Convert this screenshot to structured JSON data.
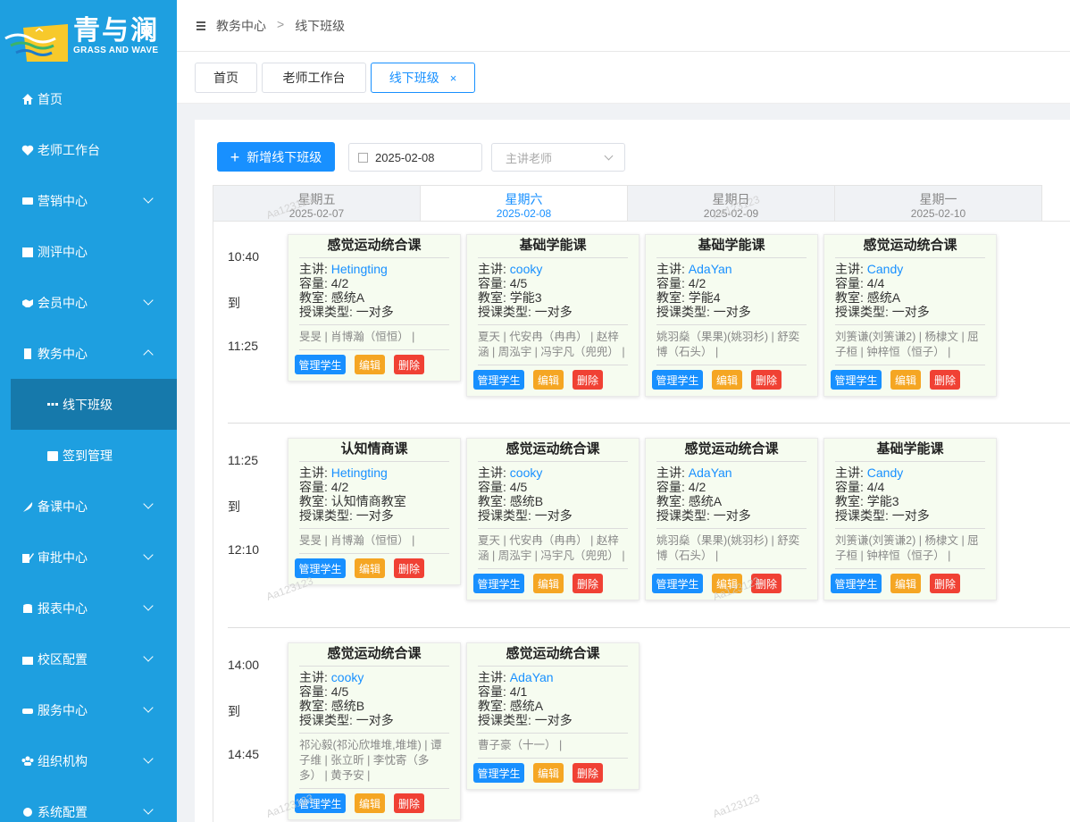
{
  "logo": {
    "cn": "青与澜",
    "en": "GRASS AND WAVE"
  },
  "sidebar": {
    "items": [
      {
        "label": "首页",
        "icon": "home-icon",
        "name": "sidebar-item-home",
        "chevron": false
      },
      {
        "label": "老师工作台",
        "icon": "heart-icon",
        "name": "sidebar-item-teacher-workbench",
        "chevron": false
      },
      {
        "label": "营销中心",
        "icon": "id-card-icon",
        "name": "sidebar-item-marketing",
        "chevron": true
      },
      {
        "label": "测评中心",
        "icon": "calendar-grid-icon",
        "name": "sidebar-item-assessment",
        "chevron": false
      },
      {
        "label": "会员中心",
        "icon": "handshake-icon",
        "name": "sidebar-item-members",
        "chevron": true
      },
      {
        "label": "教务中心",
        "icon": "building-icon",
        "name": "sidebar-item-academic",
        "chevron": true,
        "open": true
      },
      {
        "label": "线下班级",
        "icon": "grid-icon",
        "name": "sidebar-item-offline-class",
        "sub": true,
        "active": true
      },
      {
        "label": "签到管理",
        "icon": "calendar-check-icon",
        "name": "sidebar-item-checkin",
        "sub": true
      },
      {
        "label": "备课中心",
        "icon": "feather-icon",
        "name": "sidebar-item-lesson-prep",
        "chevron": true
      },
      {
        "label": "审批中心",
        "icon": "edit-icon",
        "name": "sidebar-item-approval",
        "chevron": true
      },
      {
        "label": "报表中心",
        "icon": "coins-icon",
        "name": "sidebar-item-reports",
        "chevron": true
      },
      {
        "label": "校区配置",
        "icon": "school-icon",
        "name": "sidebar-item-campus",
        "chevron": true
      },
      {
        "label": "服务中心",
        "icon": "sofa-icon",
        "name": "sidebar-item-service",
        "chevron": true
      },
      {
        "label": "组织机构",
        "icon": "users-icon",
        "name": "sidebar-item-organization",
        "chevron": true
      },
      {
        "label": "系统配置",
        "icon": "gear-icon",
        "name": "sidebar-item-system",
        "chevron": true
      }
    ]
  },
  "breadcrumb": {
    "parent": "教务中心",
    "sep": ">",
    "current": "线下班级"
  },
  "tabs": [
    {
      "label": "首页"
    },
    {
      "label": "老师工作台"
    },
    {
      "label": "线下班级",
      "close": "×"
    }
  ],
  "toolbar": {
    "add_label": "新增线下班级",
    "plus": "+",
    "date_value": "2025-02-08",
    "teacher_placeholder": "主讲老师"
  },
  "days": [
    {
      "weekday": "星期五",
      "date": "2025-02-07"
    },
    {
      "weekday": "星期六",
      "date": "2025-02-08",
      "active": true
    },
    {
      "weekday": "星期日",
      "date": "2025-02-09"
    },
    {
      "weekday": "星期一",
      "date": "2025-02-10"
    }
  ],
  "labels": {
    "teacher": "主讲: ",
    "capacity": "容量: ",
    "room": "教室: ",
    "type": "授课类型: ",
    "manage": "管理学生",
    "edit": "编辑",
    "delete": "删除",
    "to": "到"
  },
  "slots": [
    {
      "start": "10:40",
      "end": "11:25",
      "cards": [
        {
          "title": "感觉运动统合课",
          "teacher": "Hetingting",
          "capacity": "4/2",
          "room": "感统A",
          "type": "一对多",
          "students": "旻旻 | 肖博瀚（恒恒） |"
        },
        {
          "title": "基础学能课",
          "teacher": "cooky",
          "capacity": "4/5",
          "room": "学能3",
          "type": "一对多",
          "students": "夏天 | 代安冉（冉冉） | 赵梓涵 | 周泓宇 | 冯宇凡（兜兜） |"
        },
        {
          "title": "基础学能课",
          "teacher": "AdaYan",
          "capacity": "4/2",
          "room": "学能4",
          "type": "一对多",
          "students": "姚羽燊（果果)(姚羽杉) | 舒奕博（石头） |"
        },
        {
          "title": "感觉运动统合课",
          "teacher": "Candy",
          "capacity": "4/4",
          "room": "感统A",
          "type": "一对多",
          "students": "刘箦谦(刘箦谦2) | 杨棣文 | 屈子桓 | 钟梓恒（恒子） |"
        }
      ]
    },
    {
      "start": "11:25",
      "end": "12:10",
      "cards": [
        {
          "title": "认知情商课",
          "teacher": "Hetingting",
          "capacity": "4/2",
          "room": "认知情商教室",
          "type": "一对多",
          "students": "旻旻 | 肖博瀚（恒恒） |"
        },
        {
          "title": "感觉运动统合课",
          "teacher": "cooky",
          "capacity": "4/5",
          "room": "感统B",
          "type": "一对多",
          "students": "夏天 | 代安冉（冉冉） | 赵梓涵 | 周泓宇 | 冯宇凡（兜兜） |"
        },
        {
          "title": "感觉运动统合课",
          "teacher": "AdaYan",
          "capacity": "4/2",
          "room": "感统A",
          "type": "一对多",
          "students": "姚羽燊（果果)(姚羽杉) | 舒奕博（石头） |"
        },
        {
          "title": "基础学能课",
          "teacher": "Candy",
          "capacity": "4/4",
          "room": "学能3",
          "type": "一对多",
          "students": "刘箦谦(刘箦谦2) | 杨棣文 | 屈子桓 | 钟梓恒（恒子） |"
        }
      ]
    },
    {
      "start": "14:00",
      "end": "14:45",
      "cards": [
        {
          "title": "感觉运动统合课",
          "teacher": "cooky",
          "capacity": "4/5",
          "room": "感统B",
          "type": "一对多",
          "students": "祁沁毅(祁沁欣堆堆,堆堆) | 谭子维 | 张立昕 | 李忱寄（多多） | 黄予安 |"
        },
        {
          "title": "感觉运动统合课",
          "teacher": "AdaYan",
          "capacity": "4/1",
          "room": "感统A",
          "type": "一对多",
          "students": "曹子豪（十一） |"
        }
      ]
    }
  ],
  "watermark": "Aa123123",
  "colors": {
    "sidebar": "#1e9fe0",
    "primary": "#1890ff",
    "edit": "#f5a623",
    "delete": "#f04134",
    "card_bg": "#f6fcf0"
  }
}
